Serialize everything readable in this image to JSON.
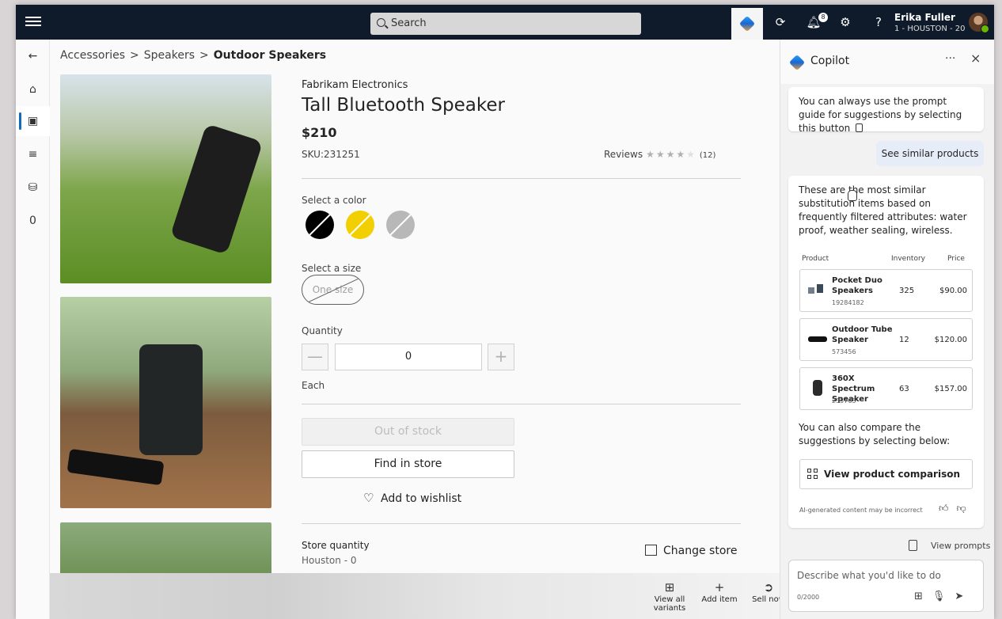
{
  "topbar": {
    "search_placeholder": "Search",
    "notifications_count": "8",
    "user_name": "Erika Fuller",
    "user_store": "1 - HOUSTON - 20",
    "help_label": "?"
  },
  "rail": {
    "items": [
      "back",
      "home",
      "products",
      "list",
      "bag",
      "count"
    ],
    "count_value": "0"
  },
  "breadcrumb": {
    "items": [
      "Accessories",
      "Speakers"
    ],
    "current": "Outdoor Speakers",
    "separator": ">"
  },
  "product": {
    "brand": "Fabrikam Electronics",
    "title": "Tall Bluetooth Speaker",
    "price": "$210",
    "sku": "SKU:231251",
    "reviews_label": "Reviews",
    "rating": 4,
    "rating_max": 5,
    "reviews_count": "(12)",
    "select_color_label": "Select a color",
    "colors": [
      "#000000",
      "#f2cf00",
      "#b8b8b8"
    ],
    "select_size_label": "Select a size",
    "size_option": "One size",
    "quantity_label": "Quantity",
    "quantity_value": "0",
    "quantity_minus": "—",
    "quantity_plus": "+",
    "unit_label": "Each",
    "out_of_stock_label": "Out of stock",
    "find_in_store_label": "Find in store",
    "wishlist_label": "Add to wishlist",
    "store_quantity_label": "Store quantity",
    "store_location": "Houston - 0",
    "change_store_label": "Change store"
  },
  "actions": {
    "view_all_variants": "View all variants",
    "add_item": "Add item",
    "sell_now": "Sell now"
  },
  "copilot": {
    "title": "Copilot",
    "more_label": "···",
    "close_label": "×",
    "guide_text": "You can always use the prompt guide for suggestions by selecting this button",
    "suggestion_chip": "See similar products",
    "intro": "These are the most similar substitution items based on frequently filtered attributes: water proof, weather sealing, wireless.",
    "table_headers": {
      "product": "Product",
      "inventory": "Inventory",
      "price": "Price"
    },
    "products": [
      {
        "name": "Pocket Duo Speakers",
        "sku": "19284182",
        "inventory": "325",
        "price": "$90.00"
      },
      {
        "name": "Outdoor Tube Speaker",
        "sku": "573456",
        "inventory": "12",
        "price": "$120.00"
      },
      {
        "name": "360X Spectrum Speaker",
        "sku": "235765",
        "inventory": "63",
        "price": "$157.00"
      }
    ],
    "compare_text": "You can also compare the suggestions by selecting below:",
    "compare_button": "View product comparison",
    "ai_note": "AI-generated content may be incorrect",
    "view_prompts": "View prompts",
    "composer_placeholder": "Describe what you'd like to do",
    "composer_counter": "0/2000"
  }
}
